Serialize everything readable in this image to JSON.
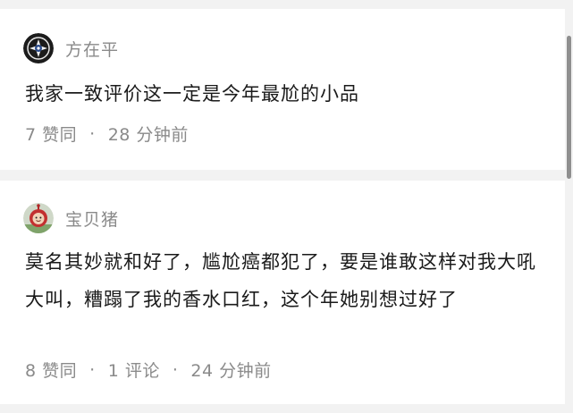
{
  "comments": [
    {
      "username": "方在平",
      "avatar_icon": "emblem-avatar-icon",
      "text": "我家一致评价这一定是今年最尬的小品",
      "likes": "7 赞同",
      "time": "28 分钟前"
    },
    {
      "username": "宝贝猪",
      "avatar_icon": "teletubby-avatar-icon",
      "text": "莫名其妙就和好了，尴尬癌都犯了，要是谁敢这样对我大吼大叫，糟蹋了我的香水口红，这个年她别想过好了",
      "likes": "8 赞同",
      "replies": "1 评论",
      "time": "24 分钟前"
    }
  ],
  "meta_separator": "·"
}
